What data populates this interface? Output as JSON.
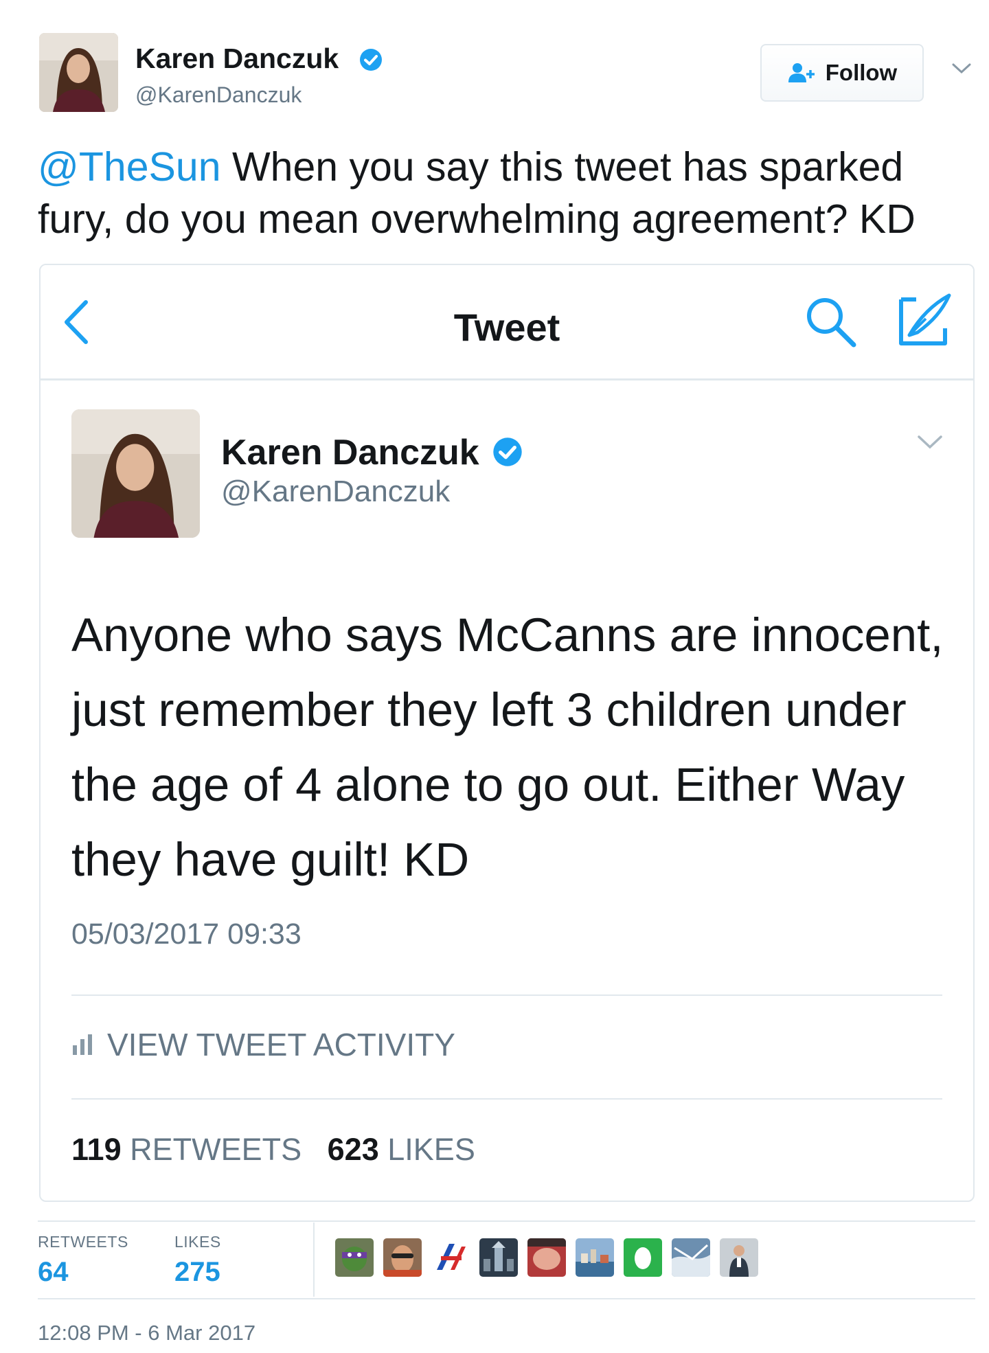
{
  "tweet": {
    "author_name": "Karen Danczuk",
    "author_handle": "@KarenDanczuk",
    "follow_label": "Follow",
    "mention": "@TheSun",
    "text": " When you say this tweet has sparked fury, do you mean overwhelming agreement? KD",
    "retweets_label": "RETWEETS",
    "retweets_count": "64",
    "likes_label": "LIKES",
    "likes_count": "275",
    "timestamp": "12:08 PM - 6 Mar 2017",
    "liker_avatars": [
      "turtle-avatar",
      "man-face-avatar",
      "flag-logo-avatar",
      "building-avatar",
      "hand-avatar",
      "harbour-avatar",
      "green-egg-avatar",
      "sky-avatar",
      "presenter-avatar"
    ]
  },
  "embedded_screenshot": {
    "nav_title": "Tweet",
    "icons": [
      "back-chevron-icon",
      "search-icon",
      "compose-icon"
    ],
    "author_name": "Karen Danczuk",
    "author_handle": "@KarenDanczuk",
    "text": "Anyone who says McCanns are innocent, just remember they left 3 children under the age of 4 alone to go out. Either Way they have guilt! KD",
    "timestamp": "05/03/2017 09:33",
    "activity_label": "VIEW TWEET ACTIVITY",
    "retweets_count": "119",
    "retweets_label": "RETWEETS",
    "likes_count": "623",
    "likes_label": "LIKES"
  },
  "colors": {
    "accent": "#1b95e0",
    "text_primary": "#14171a",
    "text_secondary": "#657786",
    "border": "#e1e8ed"
  }
}
